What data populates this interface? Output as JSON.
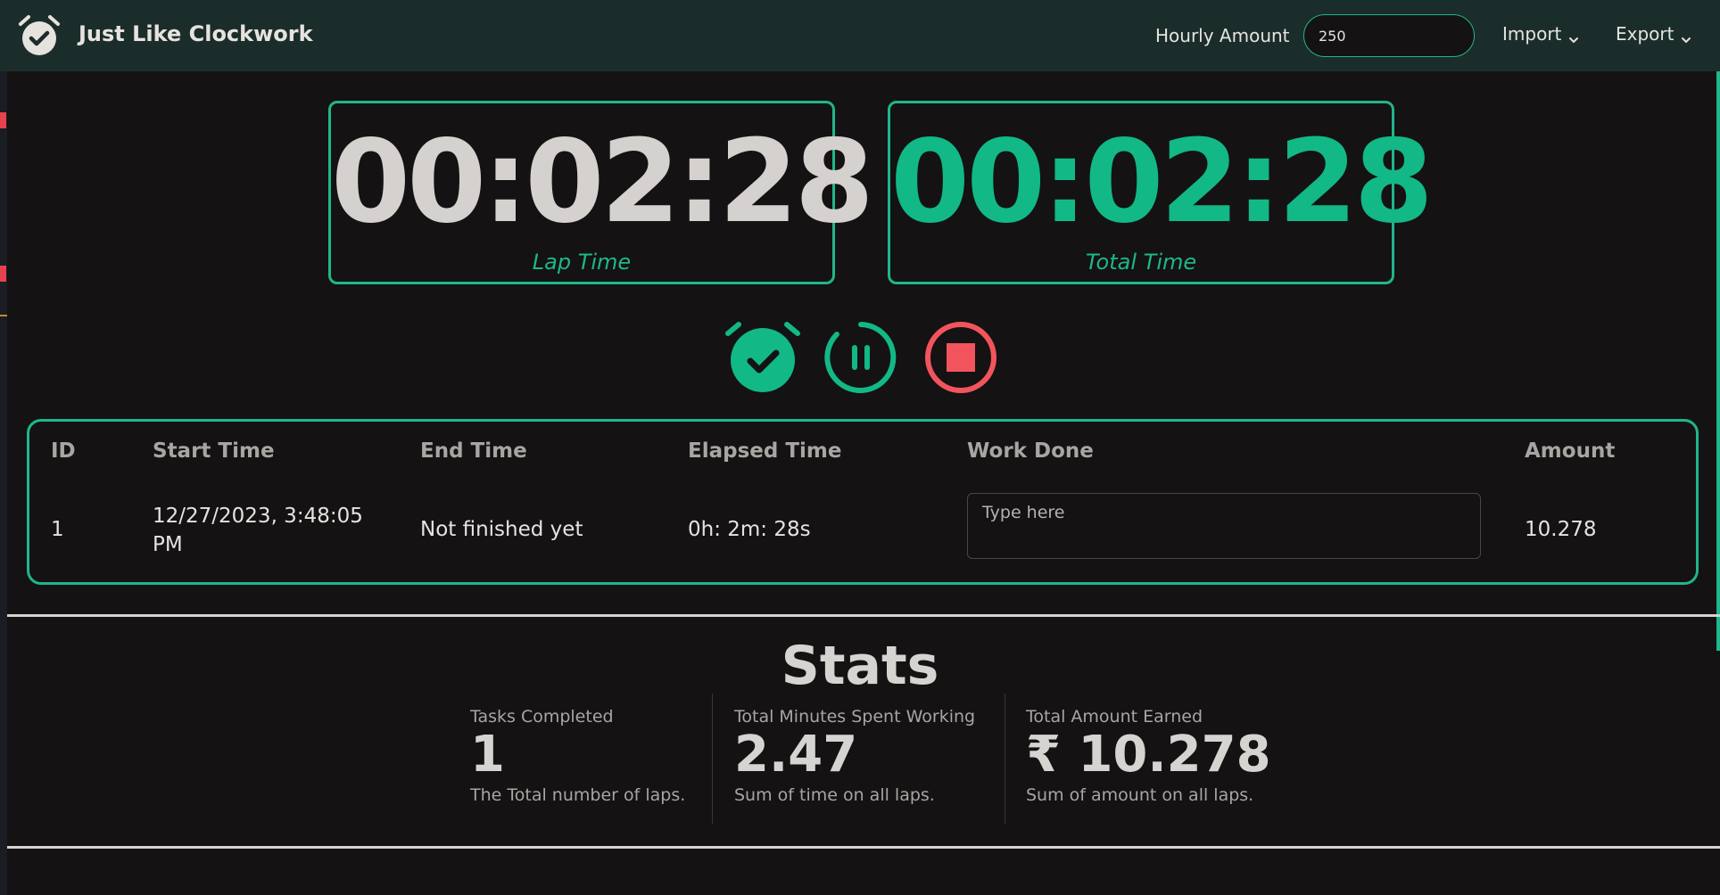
{
  "navbar": {
    "app_title": "Just Like Clockwork",
    "hourly_label": "Hourly Amount",
    "hourly_value": "250",
    "import_label": "Import",
    "export_label": "Export"
  },
  "timers": {
    "lap": {
      "value": "00:02:28",
      "label": "Lap Time"
    },
    "total": {
      "value": "00:02:28",
      "label": "Total Time"
    }
  },
  "controls": {
    "lap_icon": "alarm-check-icon",
    "pause_icon": "pause-icon",
    "stop_icon": "stop-icon"
  },
  "laps_table": {
    "headers": [
      "ID",
      "Start Time",
      "End Time",
      "Elapsed Time",
      "Work Done",
      "Amount"
    ],
    "rows": [
      {
        "id": "1",
        "start_time": "12/27/2023, 3:48:05 PM",
        "end_time": "Not finished yet",
        "elapsed": "0h: 2m: 28s",
        "work_placeholder": "Type here",
        "amount": "10.278"
      }
    ]
  },
  "stats": {
    "title": "Stats",
    "items": [
      {
        "label": "Tasks Completed",
        "value": "1",
        "desc": "The Total number of laps."
      },
      {
        "label": "Total Minutes Spent Working",
        "value": "2.47",
        "desc": "Sum of time on all laps."
      },
      {
        "label": "Total Amount Earned",
        "value": "₹ 10.278",
        "desc": "Sum of amount on all laps."
      }
    ]
  },
  "colors": {
    "accent": "#1fb68c",
    "navbar_bg": "#1b2d2a",
    "page_bg": "#141212",
    "stop_red": "#f2545e"
  }
}
